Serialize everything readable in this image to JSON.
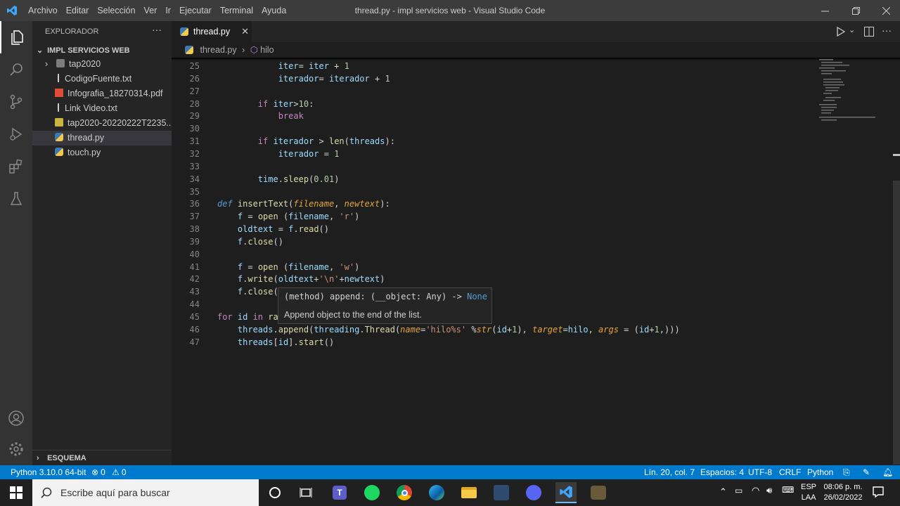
{
  "menu": [
    "Archivo",
    "Editar",
    "Selección",
    "Ver",
    "Ir",
    "Ejecutar",
    "Terminal",
    "Ayuda"
  ],
  "window_title": "thread.py - impl servicios web - Visual Studio Code",
  "explorer": {
    "title": "EXPLORADOR",
    "folder": "IMPL SERVICIOS WEB",
    "items": [
      {
        "label": "tap2020",
        "type": "folder"
      },
      {
        "label": "CodigoFuente.txt",
        "type": "txt"
      },
      {
        "label": "Infografia_18270314.pdf",
        "type": "pdf"
      },
      {
        "label": "Link Video.txt",
        "type": "txt"
      },
      {
        "label": "tap2020-20220222T2235...",
        "type": "zip"
      },
      {
        "label": "thread.py",
        "type": "py"
      },
      {
        "label": "touch.py",
        "type": "py"
      }
    ],
    "outline": "ESQUEMA"
  },
  "tab": {
    "label": "thread.py"
  },
  "breadcrumb": {
    "file": "thread.py",
    "symbol": "hilo"
  },
  "lines": [
    {
      "n": "25",
      "tokens": [
        {
          "t": "            iter",
          "c": "var"
        },
        {
          "t": "= ",
          "c": "op"
        },
        {
          "t": "iter",
          "c": "var"
        },
        {
          "t": " + ",
          "c": "op"
        },
        {
          "t": "1",
          "c": "num"
        }
      ]
    },
    {
      "n": "26",
      "tokens": [
        {
          "t": "            iterador",
          "c": "var"
        },
        {
          "t": "= ",
          "c": "op"
        },
        {
          "t": "iterador",
          "c": "var"
        },
        {
          "t": " + ",
          "c": "op"
        },
        {
          "t": "1",
          "c": "num"
        }
      ]
    },
    {
      "n": "27",
      "tokens": []
    },
    {
      "n": "28",
      "tokens": [
        {
          "t": "        if ",
          "c": "kw"
        },
        {
          "t": "iter",
          "c": "var"
        },
        {
          "t": ">",
          "c": "op"
        },
        {
          "t": "10",
          "c": "num"
        },
        {
          "t": ":",
          "c": "op"
        }
      ]
    },
    {
      "n": "29",
      "tokens": [
        {
          "t": "            break",
          "c": "kw"
        }
      ]
    },
    {
      "n": "30",
      "tokens": []
    },
    {
      "n": "31",
      "tokens": [
        {
          "t": "        if ",
          "c": "kw"
        },
        {
          "t": "iterador",
          "c": "var"
        },
        {
          "t": " > ",
          "c": "op"
        },
        {
          "t": "len",
          "c": "fn"
        },
        {
          "t": "(",
          "c": "op"
        },
        {
          "t": "threads",
          "c": "var"
        },
        {
          "t": "):",
          "c": "op"
        }
      ]
    },
    {
      "n": "32",
      "tokens": [
        {
          "t": "            iterador",
          "c": "var"
        },
        {
          "t": " = ",
          "c": "op"
        },
        {
          "t": "1",
          "c": "num"
        }
      ]
    },
    {
      "n": "33",
      "tokens": []
    },
    {
      "n": "34",
      "tokens": [
        {
          "t": "        time",
          "c": "var"
        },
        {
          "t": ".",
          "c": "op"
        },
        {
          "t": "sleep",
          "c": "fn"
        },
        {
          "t": "(",
          "c": "op"
        },
        {
          "t": "0.01",
          "c": "num"
        },
        {
          "t": ")",
          "c": "op"
        }
      ]
    },
    {
      "n": "35",
      "tokens": []
    },
    {
      "n": "36",
      "tokens": [
        {
          "t": "def ",
          "c": "def"
        },
        {
          "t": "insertText",
          "c": "fn"
        },
        {
          "t": "(",
          "c": "op"
        },
        {
          "t": "filename",
          "c": "prm"
        },
        {
          "t": ", ",
          "c": "op"
        },
        {
          "t": "newtext",
          "c": "prm"
        },
        {
          "t": "):",
          "c": "op"
        }
      ]
    },
    {
      "n": "37",
      "tokens": [
        {
          "t": "    f",
          "c": "var"
        },
        {
          "t": " = ",
          "c": "op"
        },
        {
          "t": "open",
          "c": "fn"
        },
        {
          "t": " (",
          "c": "op"
        },
        {
          "t": "filename",
          "c": "var"
        },
        {
          "t": ", ",
          "c": "op"
        },
        {
          "t": "'r'",
          "c": "str"
        },
        {
          "t": ")",
          "c": "op"
        }
      ]
    },
    {
      "n": "38",
      "tokens": [
        {
          "t": "    oldtext",
          "c": "var"
        },
        {
          "t": " = ",
          "c": "op"
        },
        {
          "t": "f",
          "c": "var"
        },
        {
          "t": ".",
          "c": "op"
        },
        {
          "t": "read",
          "c": "fn"
        },
        {
          "t": "()",
          "c": "op"
        }
      ]
    },
    {
      "n": "39",
      "tokens": [
        {
          "t": "    f",
          "c": "var"
        },
        {
          "t": ".",
          "c": "op"
        },
        {
          "t": "close",
          "c": "fn"
        },
        {
          "t": "()",
          "c": "op"
        }
      ]
    },
    {
      "n": "40",
      "tokens": []
    },
    {
      "n": "41",
      "tokens": [
        {
          "t": "    f",
          "c": "var"
        },
        {
          "t": " = ",
          "c": "op"
        },
        {
          "t": "open",
          "c": "fn"
        },
        {
          "t": " (",
          "c": "op"
        },
        {
          "t": "filename",
          "c": "var"
        },
        {
          "t": ", ",
          "c": "op"
        },
        {
          "t": "'w'",
          "c": "str"
        },
        {
          "t": ")",
          "c": "op"
        }
      ]
    },
    {
      "n": "42",
      "tokens": [
        {
          "t": "    f",
          "c": "var"
        },
        {
          "t": ".",
          "c": "op"
        },
        {
          "t": "write",
          "c": "fn"
        },
        {
          "t": "(",
          "c": "op"
        },
        {
          "t": "oldtext",
          "c": "var"
        },
        {
          "t": "+",
          "c": "op"
        },
        {
          "t": "'\\n'",
          "c": "str"
        },
        {
          "t": "+",
          "c": "op"
        },
        {
          "t": "newtext",
          "c": "var"
        },
        {
          "t": ")",
          "c": "op"
        }
      ]
    },
    {
      "n": "43",
      "tokens": [
        {
          "t": "    f",
          "c": "var"
        },
        {
          "t": ".",
          "c": "op"
        },
        {
          "t": "close",
          "c": "fn"
        },
        {
          "t": "(",
          "c": "op"
        }
      ]
    },
    {
      "n": "44",
      "tokens": []
    },
    {
      "n": "45",
      "tokens": [
        {
          "t": "for ",
          "c": "kw"
        },
        {
          "t": "id",
          "c": "var"
        },
        {
          "t": " in ",
          "c": "kw"
        },
        {
          "t": "ra",
          "c": "fn"
        }
      ]
    },
    {
      "n": "46",
      "tokens": [
        {
          "t": "    threads",
          "c": "var"
        },
        {
          "t": ".",
          "c": "op"
        },
        {
          "t": "append",
          "c": "fn"
        },
        {
          "t": "(",
          "c": "op"
        },
        {
          "t": "threading",
          "c": "var"
        },
        {
          "t": ".",
          "c": "op"
        },
        {
          "t": "Thread",
          "c": "fn"
        },
        {
          "t": "(",
          "c": "op"
        },
        {
          "t": "name",
          "c": "prm"
        },
        {
          "t": "=",
          "c": "op"
        },
        {
          "t": "'hilo%s'",
          "c": "str"
        },
        {
          "t": " %",
          "c": "op"
        },
        {
          "t": "str",
          "c": "prm"
        },
        {
          "t": "(",
          "c": "op"
        },
        {
          "t": "id",
          "c": "var"
        },
        {
          "t": "+",
          "c": "op"
        },
        {
          "t": "1",
          "c": "num"
        },
        {
          "t": "), ",
          "c": "op"
        },
        {
          "t": "target",
          "c": "prm"
        },
        {
          "t": "=",
          "c": "op"
        },
        {
          "t": "hilo",
          "c": "var"
        },
        {
          "t": ", ",
          "c": "op"
        },
        {
          "t": "args",
          "c": "prm"
        },
        {
          "t": " = (",
          "c": "op"
        },
        {
          "t": "id",
          "c": "var"
        },
        {
          "t": "+",
          "c": "op"
        },
        {
          "t": "1",
          "c": "num"
        },
        {
          "t": ",)))",
          "c": "op"
        }
      ]
    },
    {
      "n": "47",
      "tokens": [
        {
          "t": "    threads",
          "c": "var"
        },
        {
          "t": "[",
          "c": "op"
        },
        {
          "t": "id",
          "c": "var"
        },
        {
          "t": "].",
          "c": "op"
        },
        {
          "t": "start",
          "c": "fn"
        },
        {
          "t": "()",
          "c": "op"
        }
      ]
    }
  ],
  "hover": {
    "signature": "(method) append: (__object: Any) -> ",
    "ret": "None",
    "doc": "Append object to the end of the list."
  },
  "status": {
    "python": "Python 3.10.0 64-bit",
    "errors": "0",
    "warnings": "0",
    "position": "Lín. 20, col. 7",
    "spaces": "Espacios: 4",
    "encoding": "UTF-8",
    "eol": "CRLF",
    "language": "Python"
  },
  "taskbar": {
    "search_placeholder": "Escribe aquí para buscar",
    "lang": "ESP",
    "lang2": "LAA",
    "time": "08:06 p. m.",
    "date": "26/02/2022"
  },
  "colors": {
    "accent": "#007acc",
    "titlebar": "#3c3c3c",
    "sidebar": "#252526",
    "editor": "#1e1e1e"
  }
}
